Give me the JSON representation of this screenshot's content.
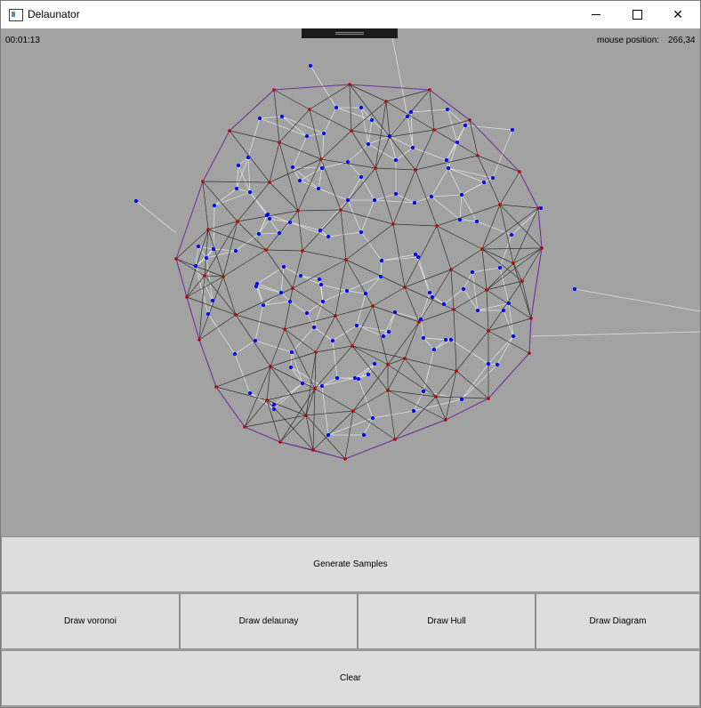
{
  "window": {
    "title": "Delaunator"
  },
  "status": {
    "timer": "00:01:13",
    "mouse_label": "mouse position:",
    "mouse_value": "266,34"
  },
  "buttons": {
    "generate": "Generate Samples",
    "voronoi": "Draw voronoi",
    "delaunay": "Draw delaunay",
    "hull": "Draw Hull",
    "diagram": "Draw Diagram",
    "clear": "Clear"
  },
  "colors": {
    "canvas": "#a2a2a2",
    "delaunay_point": "#c00000",
    "voronoi_point": "#0000ff",
    "hull": "#7030a0"
  }
}
